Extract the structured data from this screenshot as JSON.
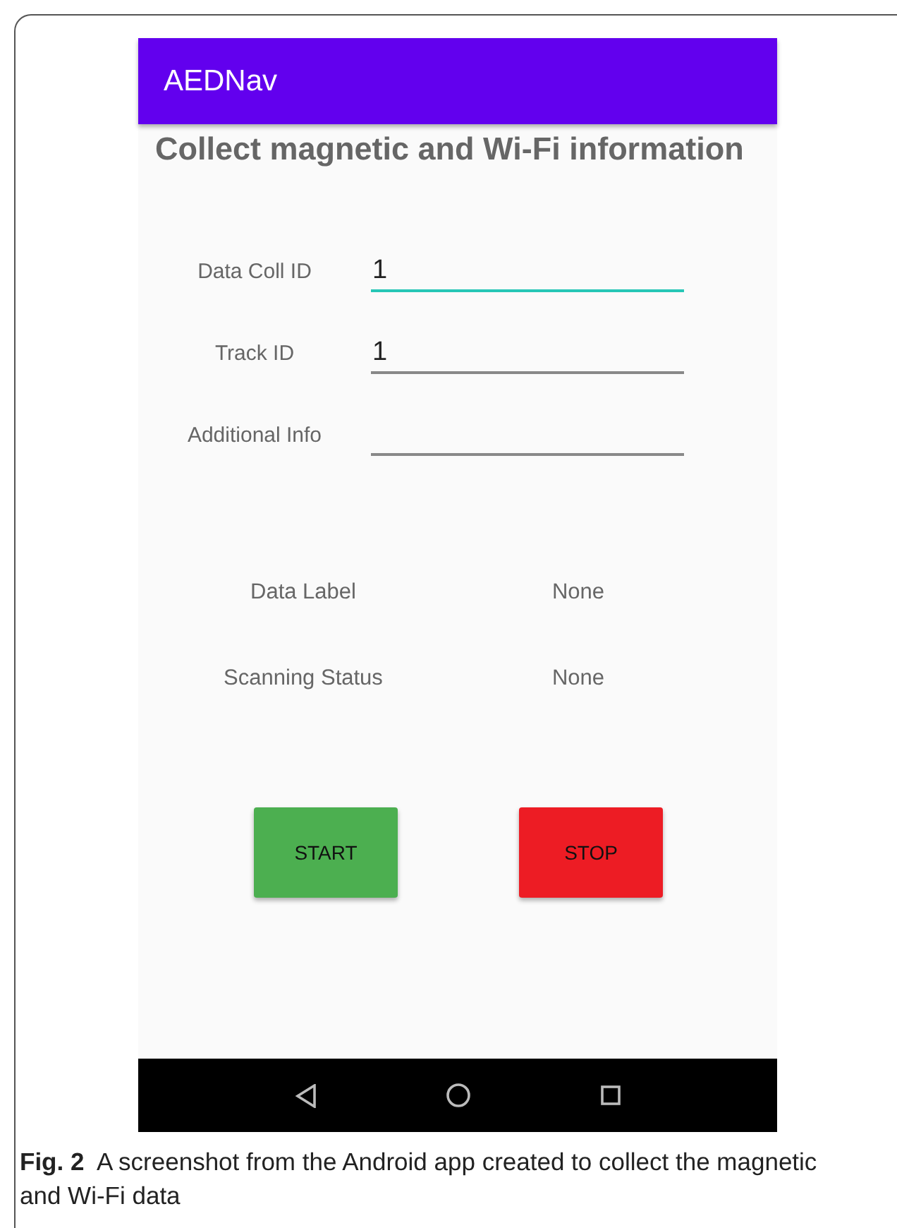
{
  "app_bar": {
    "title": "AEDNav"
  },
  "heading": "Collect magnetic and Wi-Fi information",
  "fields": [
    {
      "label": "Data Coll ID",
      "value": "1",
      "focused": true
    },
    {
      "label": "Track ID",
      "value": "1",
      "focused": false
    },
    {
      "label": "Additional Info",
      "focused": false
    }
  ],
  "status": [
    {
      "label": "Data Label",
      "value": "None"
    },
    {
      "label": "Scanning Status",
      "value": "None"
    }
  ],
  "buttons": [
    {
      "label": "START",
      "color": "#4caf50"
    },
    {
      "label": "STOP",
      "color": "#ed1c24"
    }
  ],
  "caption": {
    "number": "Fig. 2",
    "text": "A screenshot from the Android app created to collect the magnetic and Wi-Fi data"
  }
}
